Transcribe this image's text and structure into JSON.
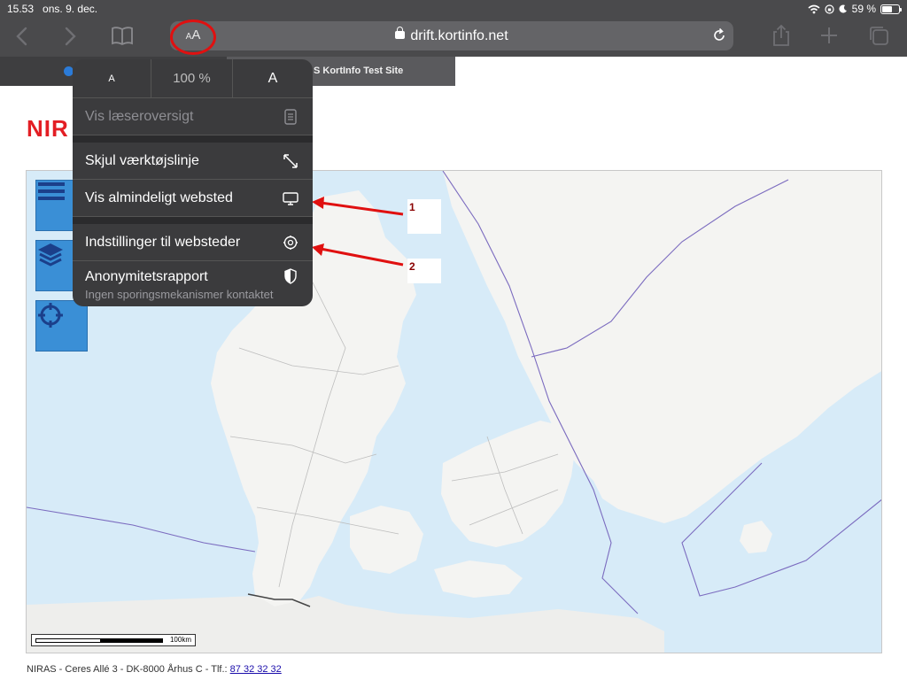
{
  "status": {
    "time": "15.53",
    "date": "ons. 9. dec.",
    "battery": "59 %",
    "battery_level": 0.59
  },
  "toolbar": {
    "aa_small": "A",
    "aa_large": "A",
    "url": "drift.kortinfo.net"
  },
  "tabs": [
    {
      "label": ""
    },
    {
      "label": "S KortInfo Test Site"
    }
  ],
  "page": {
    "logo": "NIR",
    "footer_text": "NIRAS - Ceres Allé 3 - DK-8000 Århus C - Tlf.: ",
    "footer_phone": "87 32 32 32",
    "scale_label": "100km"
  },
  "popover": {
    "zoom_small": "A",
    "zoom_value": "100 %",
    "zoom_large": "A",
    "items": [
      {
        "label": "Vis læseroversigt",
        "icon": "reader-icon"
      },
      {
        "label": "Skjul værktøjslinje",
        "icon": "resize-icon"
      },
      {
        "label": "Vis almindeligt websted",
        "icon": "desktop-icon"
      },
      {
        "label": "Indstillinger til websteder",
        "icon": "gear-icon"
      },
      {
        "label": "Anonymitetsrapport",
        "sub": "Ingen sporingsmekanismer kontaktet",
        "icon": "shield-icon"
      }
    ]
  },
  "annotations": [
    {
      "label": "1"
    },
    {
      "label": "2"
    }
  ],
  "colors": {
    "annotation_red": "#e01010",
    "map_water": "#d7ebf8",
    "map_land": "#f4f4f2",
    "map_button": "#3a8fd6"
  }
}
